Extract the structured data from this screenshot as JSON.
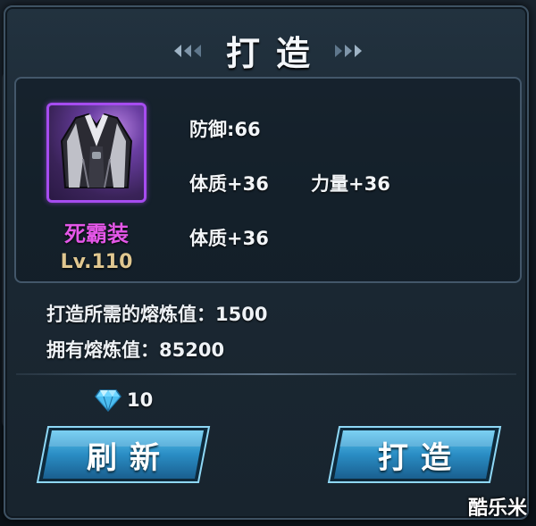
{
  "dialog": {
    "title": "打造"
  },
  "item": {
    "icon": "robe-icon",
    "name": "死霸装",
    "level": "Lv.110",
    "rarity_color": "#a64cf0"
  },
  "stats": [
    {
      "label": "防御:66"
    },
    {
      "label": "体质+36"
    },
    {
      "label": "力量+36"
    },
    {
      "label": "体质+36"
    }
  ],
  "cost": {
    "required_label": "打造所需的熔炼值：1500",
    "owned_label": "拥有熔炼值：85200"
  },
  "currency": {
    "icon": "diamond-icon",
    "amount": "10"
  },
  "buttons": {
    "refresh": "刷新",
    "forge": "打造"
  },
  "watermark": "酷乐米"
}
